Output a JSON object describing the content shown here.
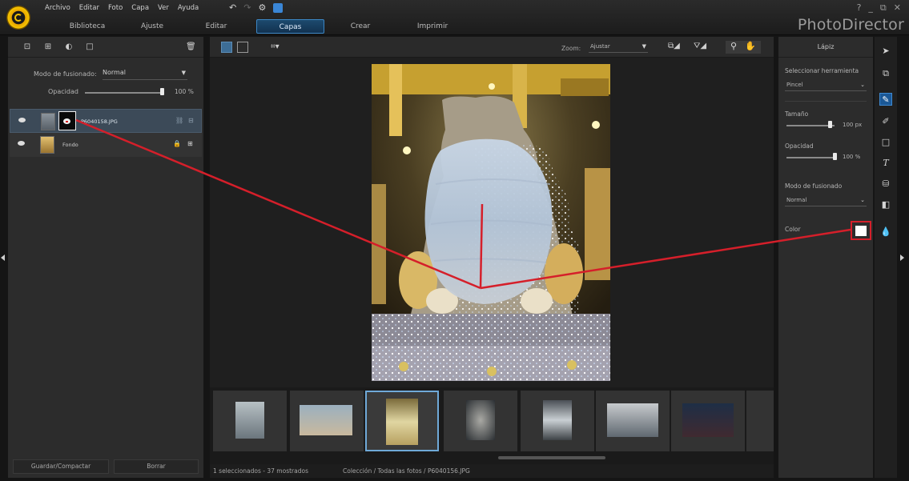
{
  "menu": [
    "Archivo",
    "Editar",
    "Foto",
    "Capa",
    "Ver",
    "Ayuda"
  ],
  "mode_tabs": [
    "Biblioteca",
    "Ajuste",
    "Editar",
    "Capas",
    "Crear",
    "Imprimir"
  ],
  "active_mode": "Capas",
  "brand": "PhotoDirector",
  "window_controls": [
    "?",
    "_",
    "⧉",
    "✕"
  ],
  "layers_panel": {
    "blend_label": "Modo de fusionado:",
    "blend_value": "Normal",
    "opacity_label": "Opacidad",
    "opacity_value": "100 %",
    "opacity_level": 1.0,
    "layers": [
      {
        "name": "P6040158.JPG",
        "selected": true
      },
      {
        "name": "Fondo",
        "selected": false
      }
    ],
    "save_button": "Guardar/Compactar",
    "delete_button": "Borrar"
  },
  "center": {
    "zoom_label": "Zoom:",
    "zoom_value": "Ajustar",
    "status_count": "1 seleccionados - 37 mostrados",
    "status_path": "Colección / Todas las fotos / P6040156.JPG",
    "thumbnails_count": 7,
    "selected_thumbnail": 3
  },
  "brush_panel": {
    "title": "Lápiz",
    "select_tool_label": "Seleccionar herramienta",
    "tool_value": "Pincel",
    "size_label": "Tamaño",
    "size_value": "100 px",
    "size_level": 0.9,
    "opacity_label": "Opacidad",
    "opacity_value": "100 %",
    "opacity_level": 1.0,
    "blend_label": "Modo de fusionado",
    "blend_value": "Normal",
    "color_label": "Color",
    "color_value": "#ffffff",
    "highlight_color": "#d51f2a"
  },
  "tool_dock": [
    "cursor-icon",
    "clone-icon",
    "brush-icon",
    "eraser-icon",
    "rectangle-icon",
    "text-icon",
    "fill-bucket-icon",
    "gradient-icon",
    "blur-icon"
  ],
  "colors": {
    "accent": "#3c86c4",
    "annotation": "#d51f2a"
  }
}
